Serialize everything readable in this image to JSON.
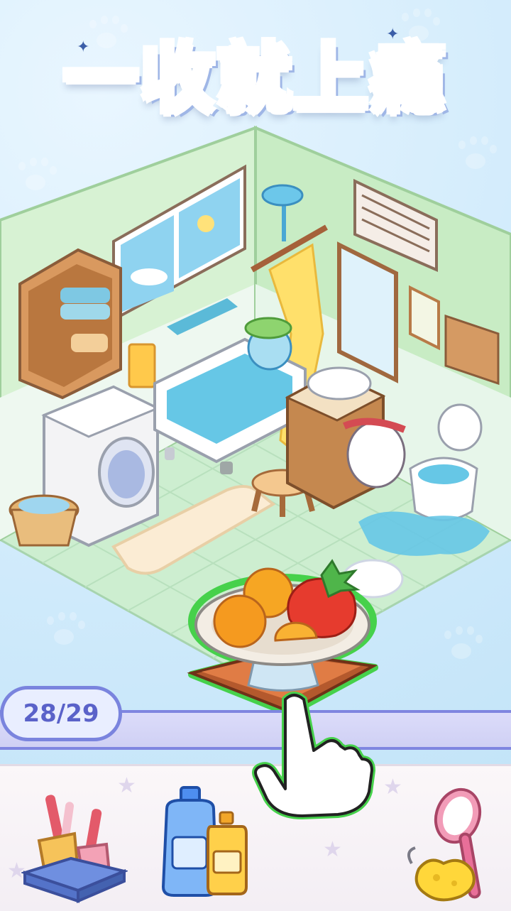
{
  "title": {
    "text": "一收就上瘾"
  },
  "counter": {
    "found": "28",
    "total": "29",
    "label": "28/29"
  },
  "colors": {
    "accent": "#7a84de",
    "highlight": "#46d14b",
    "title_pink": "#ea5ba8",
    "title_purple": "#7d6ee9"
  },
  "scene": {
    "room": "bathroom"
  },
  "featured_item": {
    "icon": "fruit-plate-icon"
  },
  "tray": {
    "items": [
      {
        "icon": "toothbrush-holder-icon"
      },
      {
        "icon": "shampoo-bottles-icon"
      },
      {
        "icon": "bath-brush-sponge-icon"
      }
    ]
  },
  "hint": {
    "icon": "tap-hand-icon"
  }
}
